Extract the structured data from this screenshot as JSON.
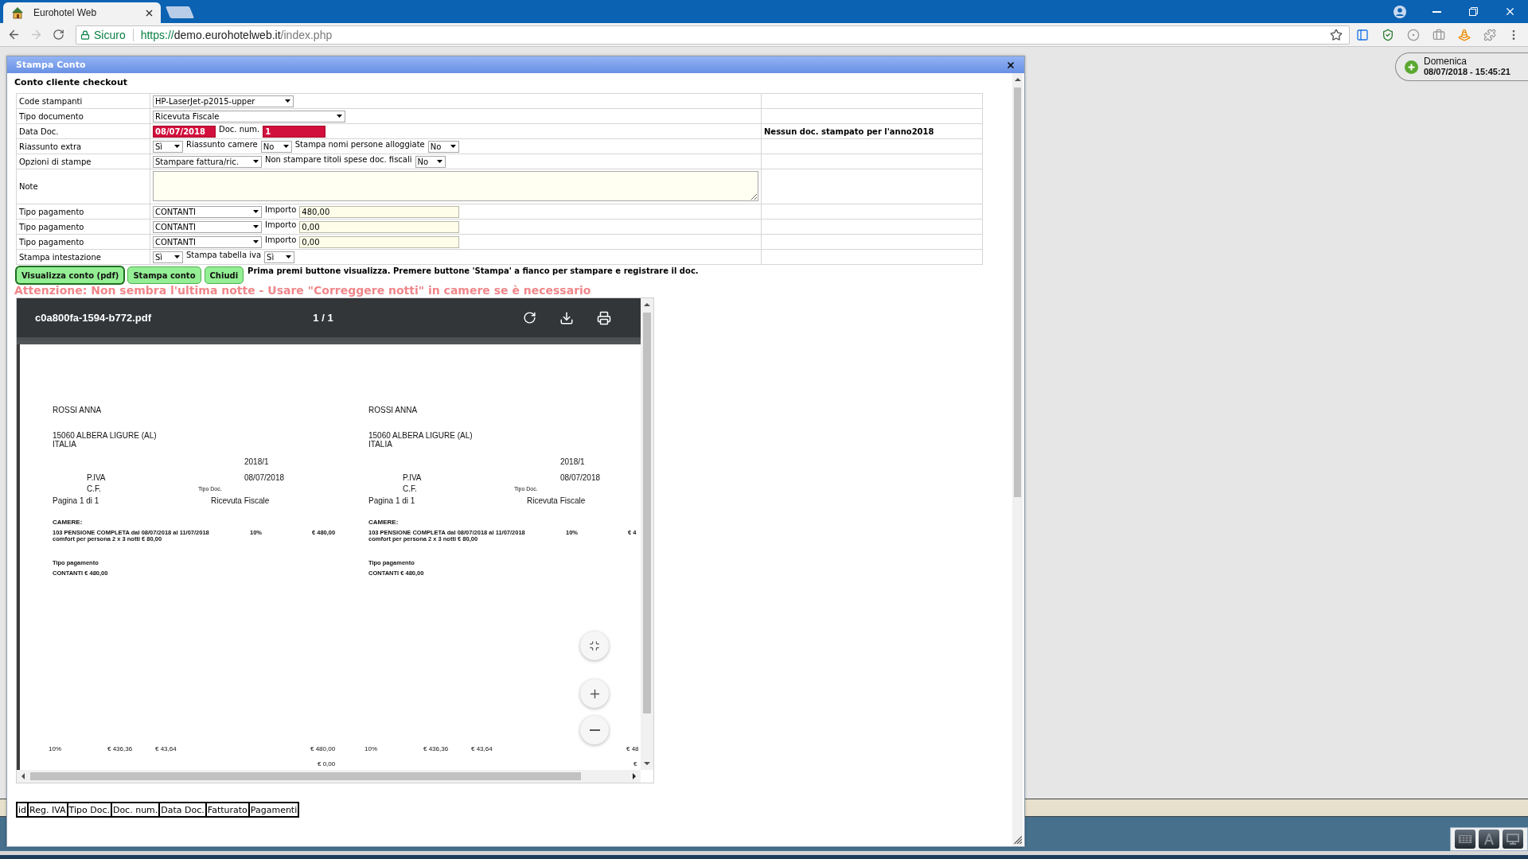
{
  "browser": {
    "tabs": [
      {
        "title": "Eurohotel Web",
        "selected": true
      }
    ],
    "navigation": {
      "back_enabled": true,
      "forward_enabled": false
    },
    "address_bar": {
      "security_label": "Sicuro",
      "url": {
        "scheme": "https://",
        "host": "demo.eurohotelweb.it",
        "path": "/index.php"
      }
    }
  },
  "clock": {
    "day": "Domenica",
    "datetime": "08/07/2018 - 15:45:21"
  },
  "dialog": {
    "title": "Stampa Conto",
    "subtitle": "Conto cliente checkout",
    "form_rows": [
      {
        "label": "Code stampanti",
        "controls": [
          {
            "kind": "select",
            "value": "HP-LaserJet-p2015-upper"
          }
        ]
      },
      {
        "label": "Tipo documento",
        "controls": [
          {
            "kind": "select",
            "value": "Ricevuta Fiscale"
          }
        ]
      },
      {
        "label": "Data Doc.",
        "controls": [
          {
            "kind": "input",
            "value": "08/07/2018",
            "highlighted": true
          },
          {
            "kind": "label",
            "text": "Doc. num."
          },
          {
            "kind": "input",
            "value": "1",
            "highlighted": true
          }
        ],
        "side_text": "Nessun doc. stampato per l'anno2018"
      },
      {
        "label": "Riassunto extra",
        "controls": [
          {
            "kind": "select",
            "value": "Sì"
          },
          {
            "kind": "label",
            "text": "Riassunto camere"
          },
          {
            "kind": "select",
            "value": "No"
          },
          {
            "kind": "label",
            "text": "Stampa nomi persone alloggiate"
          },
          {
            "kind": "select",
            "value": "No"
          }
        ]
      },
      {
        "label": "Opzioni di stampe",
        "controls": [
          {
            "kind": "select",
            "value": "Stampare fattura/ric."
          },
          {
            "kind": "label",
            "text": "Non stampare titoli spese doc. fiscali"
          },
          {
            "kind": "select",
            "value": "No"
          }
        ]
      },
      {
        "label": "Note",
        "controls": [
          {
            "kind": "textarea"
          }
        ]
      },
      {
        "label": "Tipo pagamento",
        "controls": [
          {
            "kind": "select",
            "value": "CONTANTI"
          },
          {
            "kind": "label",
            "text": "Importo"
          },
          {
            "kind": "input",
            "value": "480,00",
            "highlighted": false
          }
        ]
      },
      {
        "label": "Tipo pagamento",
        "controls": [
          {
            "kind": "select",
            "value": "CONTANTI"
          },
          {
            "kind": "label",
            "text": "Importo"
          },
          {
            "kind": "input",
            "value": "0,00",
            "highlighted": false
          }
        ]
      },
      {
        "label": "Tipo pagamento",
        "controls": [
          {
            "kind": "select",
            "value": "CONTANTI"
          },
          {
            "kind": "label",
            "text": "Importo"
          },
          {
            "kind": "input",
            "value": "0,00",
            "highlighted": false
          }
        ]
      },
      {
        "label": "Stampa intestazione",
        "controls": [
          {
            "kind": "select",
            "value": "Sì"
          },
          {
            "kind": "label",
            "text": "Stampa tabella iva"
          },
          {
            "kind": "select",
            "value": "Sì"
          }
        ]
      }
    ],
    "buttons": [
      {
        "label": "Visualizza conto (pdf)",
        "focused": true
      },
      {
        "label": "Stampa conto",
        "focused": false
      },
      {
        "label": "Chiudi",
        "focused": false
      }
    ],
    "hint": "Prima premi buttone visualizza. Premere buttone 'Stampa' a fianco per stampare e registrare il doc.",
    "warning": "Attenzione: Non sembra l'ultima notte - Usare \"Correggere notti\" in camere se è necessario",
    "pdf_viewer": {
      "filename": "c0a800fa-1594-b772.pdf",
      "page_indicator": "1 / 1",
      "document": {
        "copies": [
          {
            "customer": "ROSSI ANNA",
            "address": [
              "15060 ALBERA LIGURE (AL)",
              "ITALIA"
            ],
            "number": "2018/1",
            "vat_label": "P.IVA",
            "date": "08/07/2018",
            "tax_code_label": "C.F.",
            "doc_type_caption": "Tipo Doc.",
            "page": "Pagina 1 di 1",
            "doc_type": "Ricevuta Fiscale",
            "section": "CAMERE:",
            "item": {
              "lines": [
                "103 PENSIONE COMPLETA dal 08/07/2018 al 11/07/2018",
                "comfort per persona 2 x 3 notti € 80,00"
              ],
              "vat_rate": "10%",
              "amount": "€ 480,00"
            },
            "payment_heading": "Tipo pagamento",
            "payment": "CONTANTI € 480,00",
            "totals": {
              "vat_rate": "10%",
              "taxable": "€ 436,36",
              "tax": "€ 43,64",
              "total": "€ 480,00"
            },
            "extra": "€ 0,00"
          },
          {
            "customer": "ROSSI ANNA",
            "address": [
              "15060 ALBERA LIGURE (AL)",
              "ITALIA"
            ],
            "number": "2018/1",
            "vat_label": "P.IVA",
            "date": "08/07/2018",
            "tax_code_label": "C.F.",
            "doc_type_caption": "Tipo Doc.",
            "page": "Pagina 1 di 1",
            "doc_type": "Ricevuta Fiscale",
            "section": "CAMERE:",
            "item": {
              "lines": [
                "103 PENSIONE COMPLETA dal 08/07/2018 al 11/07/2018",
                "comfort per persona 2 x 3 notti € 80,00"
              ],
              "vat_rate": "10%",
              "amount": "€ 4"
            },
            "payment_heading": "Tipo pagamento",
            "payment": "CONTANTI € 480,00",
            "totals": {
              "vat_rate": "10%",
              "taxable": "€ 436,36",
              "tax": "€ 43,64",
              "total": "€ 48"
            },
            "extra": "€"
          }
        ]
      }
    },
    "history_table": {
      "columns": [
        "id",
        "Reg. IVA",
        "Tipo Doc.",
        "Doc. num.",
        "Data Doc.",
        "Fatturato",
        "Pagamenti"
      ]
    }
  }
}
